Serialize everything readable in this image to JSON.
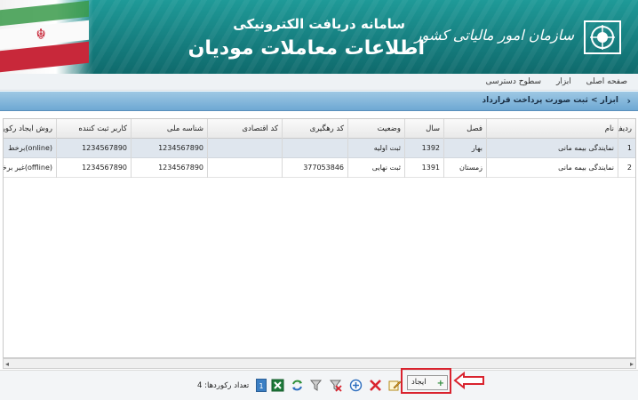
{
  "banner": {
    "subtitle": "سامانه دریافت الکترونیکی",
    "title": "اطلاعات معاملات مودیان",
    "org_name": "سازمان امور مالیاتی کشور"
  },
  "menu": {
    "items": [
      "صفحه اصلی",
      "ابزار",
      "سطوح دسترسی"
    ]
  },
  "breadcrumb": {
    "text": "ابزار > ثبت صورت پرداخت قرارداد"
  },
  "grid": {
    "headers": {
      "idx": "ردیف",
      "name": "نام",
      "fasl": "فصل",
      "sal": "سال",
      "vaziat": "وضعیت",
      "rahgiri": "کد رهگیری",
      "eqtesadi": "کد اقتصادی",
      "melli": "شناسه ملی",
      "karbar": "کاربر ثبت کننده",
      "ravesh": "روش ایجاد رکورد"
    },
    "rows": [
      {
        "idx": "1",
        "name": "نمایندگی بیمه مانی",
        "fasl": "بهار",
        "sal": "1392",
        "vaziat": "ثبت اولیه",
        "rahgiri": "",
        "eqtesadi": "",
        "melli": "1234567890",
        "karbar": "1234567890",
        "ravesh": "(online)برخط"
      },
      {
        "idx": "2",
        "name": "نمایندگی بیمه مانی",
        "fasl": "زمستان",
        "sal": "1391",
        "vaziat": "ثبت نهایی",
        "rahgiri": "377053846",
        "eqtesadi": "",
        "melli": "1234567890",
        "karbar": "1234567890",
        "ravesh": "(offline)غیر برخط"
      }
    ]
  },
  "toolbar": {
    "create_label": "ایجاد",
    "record_count": "تعداد رکوردها: 4",
    "page": "1"
  },
  "colors": {
    "banner": "#167f80",
    "crumbbar": "#6ea8d3",
    "selected_row": "#dfe6ee",
    "highlight": "#d9232e"
  }
}
